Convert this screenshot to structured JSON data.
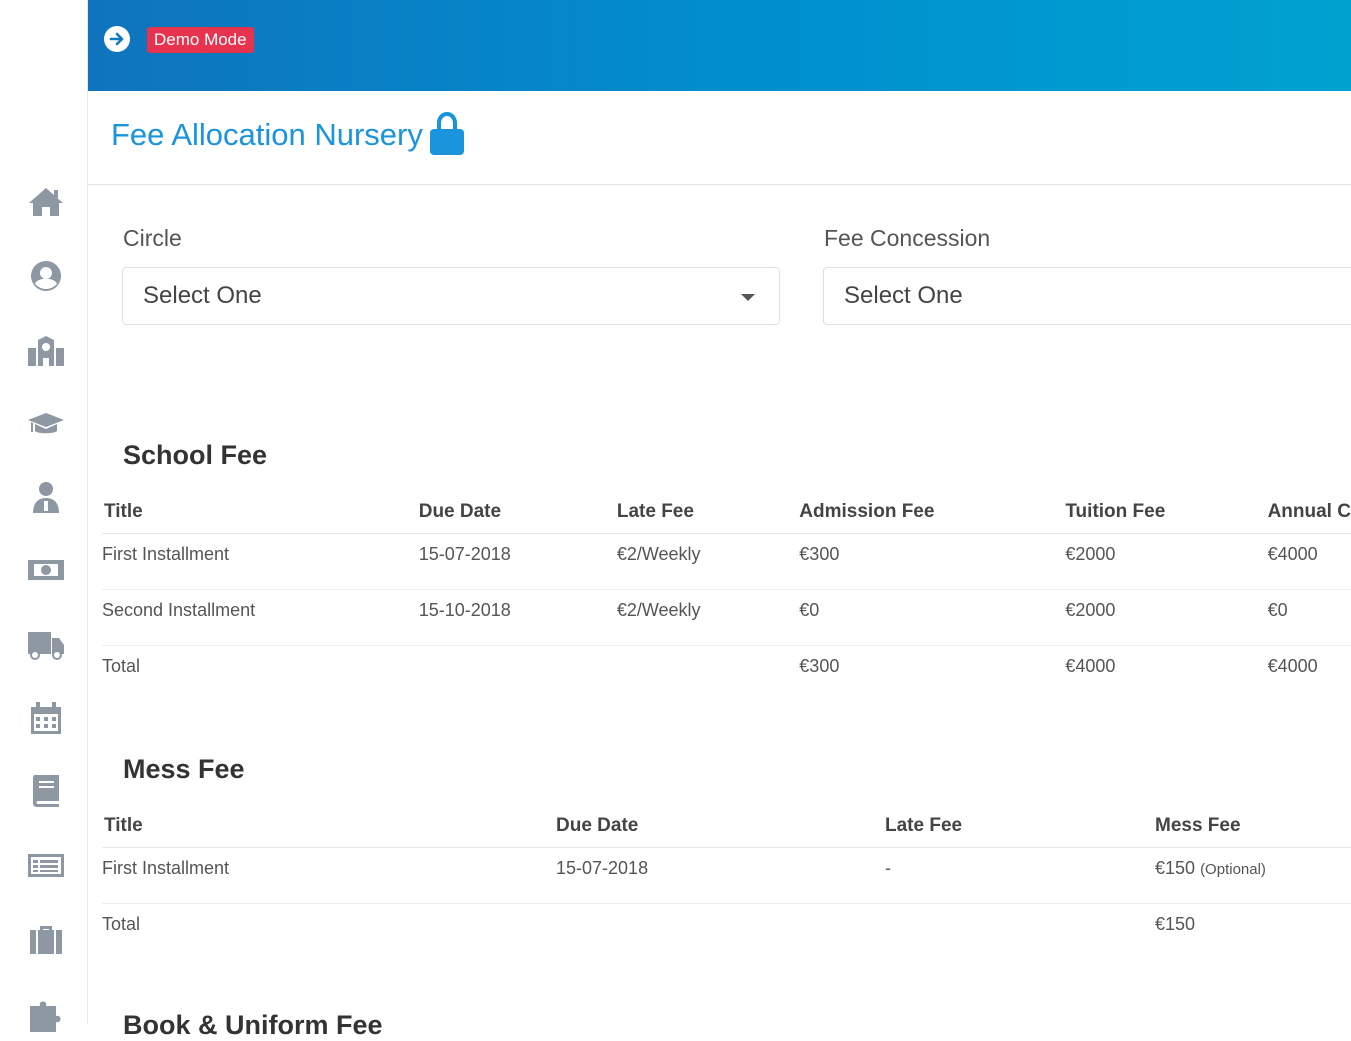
{
  "topbar": {
    "demo_label": "Demo Mode"
  },
  "page": {
    "title": "Fee Allocation Nursery"
  },
  "filters": {
    "circle": {
      "label": "Circle",
      "value": "Select One"
    },
    "concession": {
      "label": "Fee Concession",
      "value": "Select One"
    }
  },
  "school_fee": {
    "title": "School Fee",
    "headers": [
      "Title",
      "Due Date",
      "Late Fee",
      "Admission Fee",
      "Tuition Fee",
      "Annual C"
    ],
    "rows": [
      [
        "First Installment",
        "15-07-2018",
        "€2/Weekly",
        "€300",
        "€2000",
        "€4000"
      ],
      [
        "Second Installment",
        "15-10-2018",
        "€2/Weekly",
        "€0",
        "€2000",
        "€0"
      ],
      [
        "Total",
        "",
        "",
        "€300",
        "€4000",
        "€4000"
      ]
    ]
  },
  "mess_fee": {
    "title": "Mess Fee",
    "headers": [
      "Title",
      "Due Date",
      "Late Fee",
      "Mess Fee"
    ],
    "rows": [
      [
        "First Installment",
        "15-07-2018",
        "-",
        "€150"
      ],
      [
        "Total",
        "",
        "",
        "€150"
      ]
    ],
    "optional_note": "(Optional)"
  },
  "book_fee": {
    "title": "Book & Uniform Fee"
  },
  "sidebar_icons": [
    "home-icon",
    "user-circle-icon",
    "school-icon",
    "graduation-cap-icon",
    "teacher-icon",
    "money-icon",
    "truck-icon",
    "calendar-icon",
    "book-icon",
    "list-icon",
    "briefcase-icon",
    "puzzle-icon"
  ],
  "colors": {
    "accent": "#1a94dd",
    "demo_badge": "#e8334f",
    "topbar_start": "#0f74bd",
    "topbar_end": "#00a2d0",
    "sidebar_icon": "#8d98a3"
  }
}
